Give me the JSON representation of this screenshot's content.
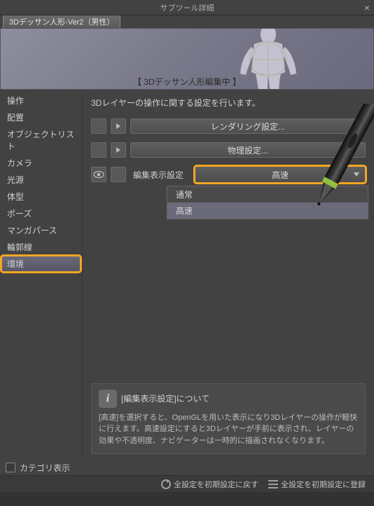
{
  "titlebar": {
    "title": "サブツール詳細"
  },
  "subtitle_tab": "3Dデッサン人形-Ver2（男性）",
  "preview_label": "【 3Dデッサン人形編集中 】",
  "sidebar": {
    "items": [
      {
        "label": "操作"
      },
      {
        "label": "配置"
      },
      {
        "label": "オブジェクトリスト"
      },
      {
        "label": "カメラ"
      },
      {
        "label": "光源"
      },
      {
        "label": "体型"
      },
      {
        "label": "ポーズ"
      },
      {
        "label": "マンガパース"
      },
      {
        "label": "輪郭線"
      },
      {
        "label": "環境"
      }
    ],
    "selected_index": 9
  },
  "main": {
    "intro": "3Dレイヤーの操作に関する設定を行います。",
    "rendering_btn": "レンダリング設定...",
    "physics_btn": "物理設定...",
    "edit_display_label": "編集表示設定",
    "dropdown_value": "高速",
    "dropdown_options": [
      "通常",
      "高速"
    ],
    "dropdown_selected_index": 1
  },
  "info": {
    "title": "[編集表示設定]について",
    "body": "[高速]を選択すると、OpenGLを用いた表示になり3Dレイヤーの操作が軽快に行えます。高速設定にすると3Dレイヤーが手前に表示され、レイヤーの効果や不透明度、ナビゲーターは一時的に描画されなくなります。"
  },
  "bottom": {
    "category_display": "カテゴリ表示",
    "reset_all": "全設定を初期設定に戻す",
    "register_all": "全設定を初期設定に登録"
  }
}
